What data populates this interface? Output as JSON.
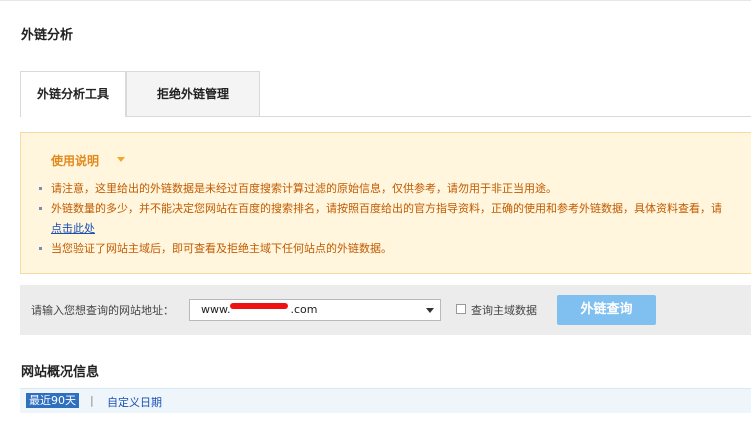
{
  "page": {
    "title": "外链分析"
  },
  "tabs": [
    {
      "label": "外链分析工具",
      "active": true
    },
    {
      "label": "拒绝外链管理",
      "active": false
    }
  ],
  "notice": {
    "title": "使用说明",
    "items": [
      {
        "text": "请注意，这里给出的外链数据是未经过百度搜索计算过滤的原始信息，仅供参考，请勿用于非正当用途。"
      },
      {
        "text_before": "外链数量的多少，并不能决定您网站在百度的搜索排名，请按照百度给出的官方指导资料，正确的使用和参考外链数据，具体资料查看，请",
        "link": "点击此处"
      },
      {
        "text": "当您验证了网站主域后，即可查看及拒绝主域下任何站点的外链数据。"
      }
    ]
  },
  "search": {
    "label": "请输入您想查询的网站地址：",
    "url_prefix": "www.",
    "url_suffix": "com",
    "checkbox_label": "查询主域数据",
    "button_label": "外链查询"
  },
  "overview": {
    "title": "网站概况信息",
    "date_active": "最近90天",
    "separator": "|",
    "date_custom": "自定义日期"
  },
  "colors": {
    "accent": "#7fc0f0",
    "notice_bg": "#fff6dd",
    "notice_text": "#c15a00",
    "date_active_bg": "#2f6fbf"
  }
}
